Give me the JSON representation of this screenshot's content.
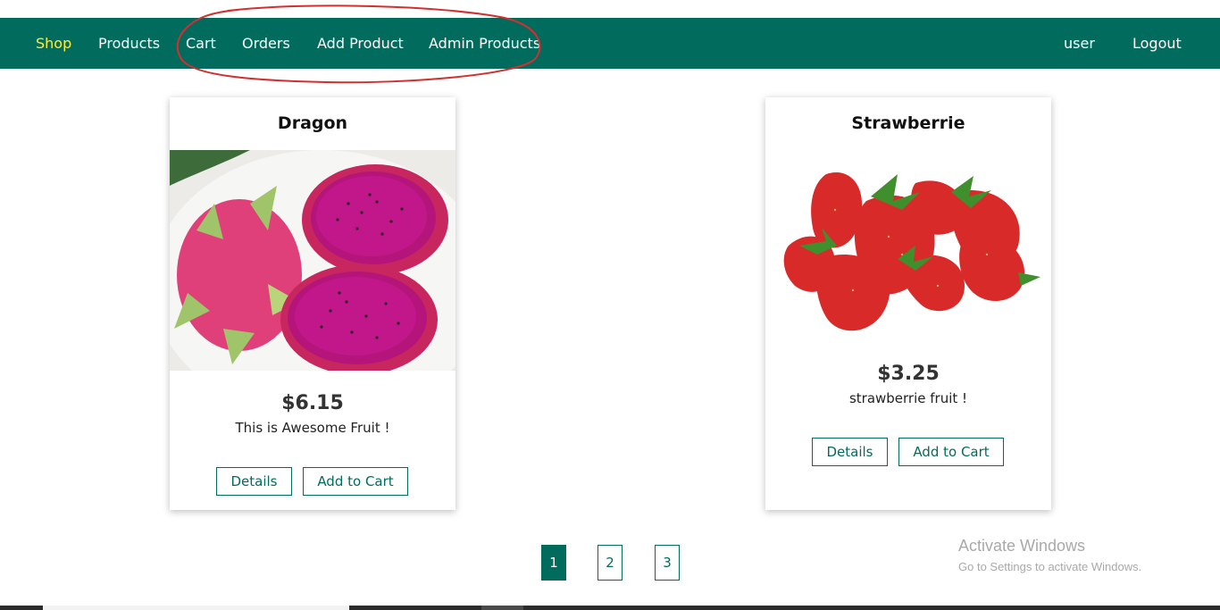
{
  "nav": {
    "left": [
      {
        "label": "Shop",
        "active": true
      },
      {
        "label": "Products"
      },
      {
        "label": "Cart"
      },
      {
        "label": "Orders"
      },
      {
        "label": "Add Product"
      },
      {
        "label": "Admin Products"
      }
    ],
    "right": [
      {
        "label": "user"
      },
      {
        "label": "Logout"
      }
    ]
  },
  "products": [
    {
      "title": "Dragon",
      "price": "$6.15",
      "description": "This is Awesome Fruit !",
      "details_label": "Details",
      "cart_label": "Add to Cart",
      "image": "dragon-fruit-image"
    },
    {
      "title": "Strawberrie",
      "price": "$3.25",
      "description": "strawberrie fruit !",
      "details_label": "Details",
      "cart_label": "Add to Cart",
      "image": "strawberry-image"
    }
  ],
  "pagination": {
    "pages": [
      "1",
      "2",
      "3"
    ],
    "current": "1"
  },
  "watermark": {
    "title": "Activate Windows",
    "subtitle": "Go to Settings to activate Windows."
  },
  "colors": {
    "primary": "#016c5d",
    "active_nav": "#ffeb3b",
    "annotation": "#d32f2f"
  }
}
